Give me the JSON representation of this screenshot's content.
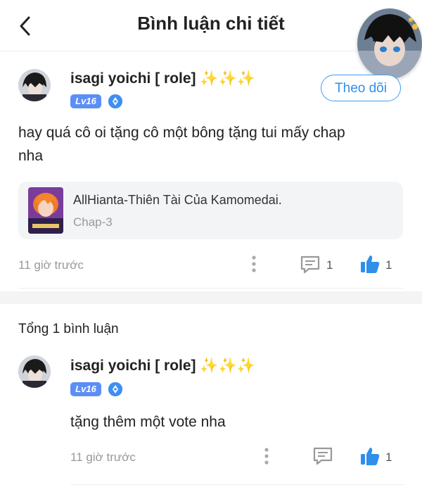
{
  "header": {
    "title": "Bình luận chi tiết"
  },
  "main_comment": {
    "username": "isagi yoichi [ role]",
    "sparkles": "✨✨✨",
    "level": "Lv16",
    "follow_label": "Theo dõi",
    "text_line1": "hay quá cô oi tặng cô một bông tặng tui mấy chap",
    "text_line2": "nha",
    "book": {
      "title": "AllHianta-Thiên Tài Của Kamomedai.",
      "chapter": "Chap-3"
    },
    "time": "11 giờ trước",
    "reply_count": "1",
    "like_count": "1"
  },
  "replies_section": {
    "total_label": "Tổng 1 bình luận"
  },
  "reply": {
    "username": "isagi yoichi [ role]",
    "sparkles": "✨✨✨",
    "level": "Lv16",
    "text": "tặng thêm một vote nha",
    "time": "11 giờ trước",
    "like_count": "1"
  },
  "colors": {
    "accent": "#2f8fea",
    "level_badge": "#5b8ef7",
    "muted": "#999999",
    "sparkle": "#f5c400"
  },
  "icons": [
    "back-arrow-icon",
    "more-vertical-icon",
    "comment-icon",
    "thumbs-up-icon",
    "rank-badge-icon"
  ]
}
